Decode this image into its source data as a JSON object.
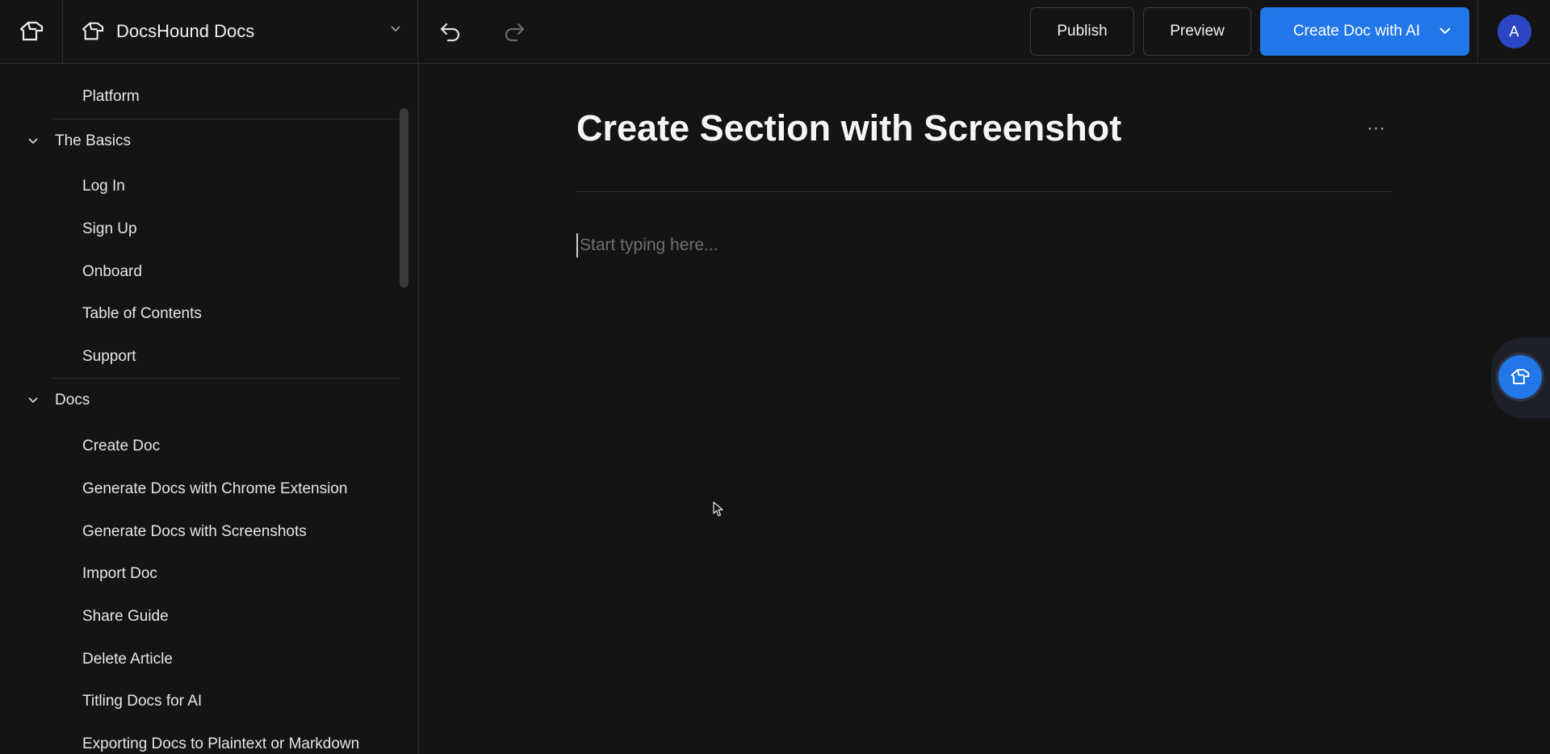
{
  "header": {
    "project_name": "DocsHound Docs",
    "publish_label": "Publish",
    "preview_label": "Preview",
    "create_ai_label": "Create Doc with AI",
    "avatar_initial": "A"
  },
  "sidebar": {
    "top_item": "Platform",
    "groups": [
      {
        "label": "The Basics",
        "items": [
          "Log In",
          "Sign Up",
          "Onboard",
          "Table of Contents",
          "Support"
        ]
      },
      {
        "label": "Docs",
        "items": [
          "Create Doc",
          "Generate Docs with Chrome Extension",
          "Generate Docs with Screenshots",
          "Import Doc",
          "Share Guide",
          "Delete Article",
          "Titling Docs for AI",
          "Exporting Docs to Plaintext or Markdown"
        ]
      }
    ]
  },
  "editor": {
    "title": "Create Section with Screenshot",
    "more_label": "···",
    "placeholder": "Start typing here..."
  },
  "colors": {
    "background": "#141414",
    "accent": "#2176e8",
    "avatar": "#2a46c4"
  }
}
